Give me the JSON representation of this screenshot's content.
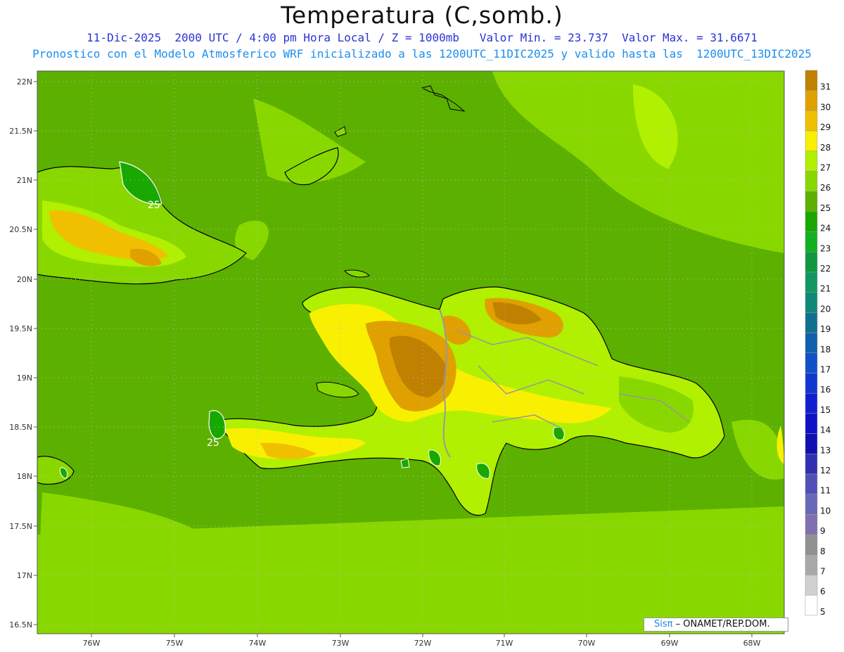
{
  "header": {
    "title": "Temperatura (C,somb.)",
    "line1": "11-Dic-2025  2000 UTC / 4:00 pm Hora Local / Z = 1000mb   Valor Min. = 23.737  Valor Max. = 31.6671",
    "line2": "Pronostico con el Modelo Atmosferico WRF inicializado a las 1200UTC_11DIC2025 y valido hasta las  1200UTC_13DIC2025"
  },
  "map": {
    "lat_labels": [
      "22N",
      "21.5N",
      "21N",
      "20.5N",
      "20N",
      "19.5N",
      "19N",
      "18.5N",
      "18N",
      "17.5N",
      "17N",
      "16.5N"
    ],
    "lon_labels": [
      "76W",
      "75W",
      "74W",
      "73W",
      "72W",
      "71W",
      "70W",
      "69W",
      "68W"
    ],
    "contour_labels": [
      "25",
      "25"
    ]
  },
  "colorbar": {
    "levels": [
      "31",
      "30",
      "29",
      "28",
      "27",
      "26",
      "25",
      "24",
      "23",
      "22",
      "21",
      "20",
      "19",
      "18",
      "17",
      "16",
      "15",
      "14",
      "13",
      "12",
      "11",
      "10",
      "9",
      "8",
      "7",
      "6",
      "5"
    ],
    "colors": [
      "#c08000",
      "#e0a000",
      "#f0c000",
      "#f8f000",
      "#b0f000",
      "#88d800",
      "#5cb000",
      "#18a800",
      "#10b020",
      "#109840",
      "#109860",
      "#108878",
      "#107090",
      "#1060b0",
      "#1050c8",
      "#1038d0",
      "#1020d0",
      "#1010c8",
      "#1010b0",
      "#3030b0",
      "#5050b8",
      "#6868b8",
      "#8070b0",
      "#909090",
      "#a8a8a8",
      "#d0d0d0",
      "#ffffff"
    ]
  },
  "credit": {
    "sis": "Sisπ",
    "rest": " – ONAMET/REP.DOM."
  },
  "colors": {
    "sea": "#5cb000",
    "land_warm": "#a8e000",
    "hot": "#c08000",
    "coast": "#000000"
  }
}
